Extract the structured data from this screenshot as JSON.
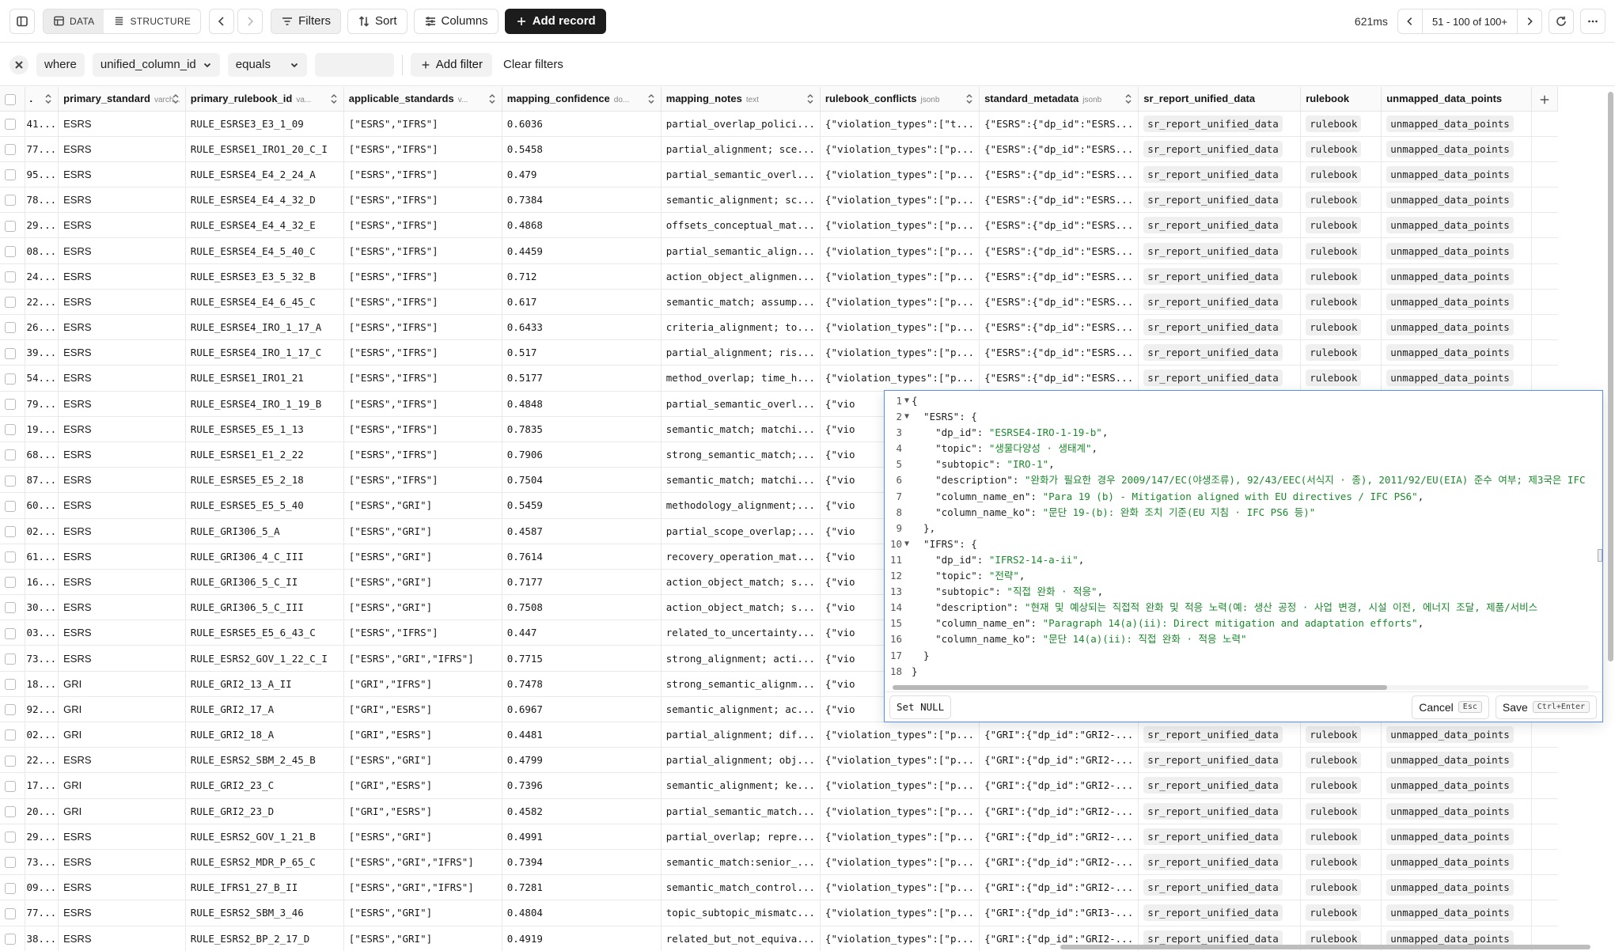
{
  "toolbar": {
    "data_label": "DATA",
    "structure_label": "STRUCTURE",
    "filters_label": "Filters",
    "sort_label": "Sort",
    "columns_label": "Columns",
    "add_record_label": "Add record",
    "timing": "621ms",
    "pagination": "51 - 100  of  100+"
  },
  "filter": {
    "where_label": "where",
    "column": "unified_column_id",
    "operator": "equals",
    "value": "",
    "add_filter_label": "Add filter",
    "clear_filters_label": "Clear filters"
  },
  "columns": [
    {
      "name": ".",
      "type": ""
    },
    {
      "name": "primary_standard",
      "type": "varch..."
    },
    {
      "name": "primary_rulebook_id",
      "type": "va..."
    },
    {
      "name": "applicable_standards",
      "type": "v..."
    },
    {
      "name": "mapping_confidence",
      "type": "do..."
    },
    {
      "name": "mapping_notes",
      "type": "text"
    },
    {
      "name": "rulebook_conflicts",
      "type": "jsonb"
    },
    {
      "name": "standard_metadata",
      "type": "jsonb"
    },
    {
      "name": "sr_report_unified_data",
      "type": ""
    },
    {
      "name": "rulebook",
      "type": ""
    },
    {
      "name": "unmapped_data_points",
      "type": ""
    }
  ],
  "rows": [
    {
      "id": "41...",
      "std": "ESRS",
      "rule": "RULE_ESRSE3_E3_1_09",
      "app": "[\"ESRS\",\"IFRS\"]",
      "conf": "0.6036",
      "notes": "partial_overlap_polici...",
      "conflicts": "{\"violation_types\":[\"t...",
      "meta": "{\"ESRS\":{\"dp_id\":\"ESRS...",
      "sr": "sr_report_unified_data",
      "rb": "rulebook",
      "un": "unmapped_data_points"
    },
    {
      "id": "77...",
      "std": "ESRS",
      "rule": "RULE_ESRSE1_IRO1_20_C_I",
      "app": "[\"ESRS\",\"IFRS\"]",
      "conf": "0.5458",
      "notes": "partial_alignment; sce...",
      "conflicts": "{\"violation_types\":[\"p...",
      "meta": "{\"ESRS\":{\"dp_id\":\"ESRS...",
      "sr": "sr_report_unified_data",
      "rb": "rulebook",
      "un": "unmapped_data_points"
    },
    {
      "id": "95...",
      "std": "ESRS",
      "rule": "RULE_ESRSE4_E4_2_24_A",
      "app": "[\"ESRS\",\"IFRS\"]",
      "conf": "0.479",
      "notes": "partial_semantic_overl...",
      "conflicts": "{\"violation_types\":[\"p...",
      "meta": "{\"ESRS\":{\"dp_id\":\"ESRS...",
      "sr": "sr_report_unified_data",
      "rb": "rulebook",
      "un": "unmapped_data_points"
    },
    {
      "id": "78...",
      "std": "ESRS",
      "rule": "RULE_ESRSE4_E4_4_32_D",
      "app": "[\"ESRS\",\"IFRS\"]",
      "conf": "0.7384",
      "notes": "semantic_alignment; sc...",
      "conflicts": "{\"violation_types\":[\"p...",
      "meta": "{\"ESRS\":{\"dp_id\":\"ESRS...",
      "sr": "sr_report_unified_data",
      "rb": "rulebook",
      "un": "unmapped_data_points"
    },
    {
      "id": "29...",
      "std": "ESRS",
      "rule": "RULE_ESRSE4_E4_4_32_E",
      "app": "[\"ESRS\",\"IFRS\"]",
      "conf": "0.4868",
      "notes": "offsets_conceptual_mat...",
      "conflicts": "{\"violation_types\":[\"p...",
      "meta": "{\"ESRS\":{\"dp_id\":\"ESRS...",
      "sr": "sr_report_unified_data",
      "rb": "rulebook",
      "un": "unmapped_data_points"
    },
    {
      "id": "08...",
      "std": "ESRS",
      "rule": "RULE_ESRSE4_E4_5_40_C",
      "app": "[\"ESRS\",\"IFRS\"]",
      "conf": "0.4459",
      "notes": "partial_semantic_align...",
      "conflicts": "{\"violation_types\":[\"p...",
      "meta": "{\"ESRS\":{\"dp_id\":\"ESRS...",
      "sr": "sr_report_unified_data",
      "rb": "rulebook",
      "un": "unmapped_data_points"
    },
    {
      "id": "24...",
      "std": "ESRS",
      "rule": "RULE_ESRSE3_E3_5_32_B",
      "app": "[\"ESRS\",\"IFRS\"]",
      "conf": "0.712",
      "notes": "action_object_alignmen...",
      "conflicts": "{\"violation_types\":[\"p...",
      "meta": "{\"ESRS\":{\"dp_id\":\"ESRS...",
      "sr": "sr_report_unified_data",
      "rb": "rulebook",
      "un": "unmapped_data_points"
    },
    {
      "id": "22...",
      "std": "ESRS",
      "rule": "RULE_ESRSE4_E4_6_45_C",
      "app": "[\"ESRS\",\"IFRS\"]",
      "conf": "0.617",
      "notes": "semantic_match; assump...",
      "conflicts": "{\"violation_types\":[\"p...",
      "meta": "{\"ESRS\":{\"dp_id\":\"ESRS...",
      "sr": "sr_report_unified_data",
      "rb": "rulebook",
      "un": "unmapped_data_points"
    },
    {
      "id": "26...",
      "std": "ESRS",
      "rule": "RULE_ESRSE4_IRO_1_17_A",
      "app": "[\"ESRS\",\"IFRS\"]",
      "conf": "0.6433",
      "notes": "criteria_alignment; to...",
      "conflicts": "{\"violation_types\":[\"p...",
      "meta": "{\"ESRS\":{\"dp_id\":\"ESRS...",
      "sr": "sr_report_unified_data",
      "rb": "rulebook",
      "un": "unmapped_data_points"
    },
    {
      "id": "39...",
      "std": "ESRS",
      "rule": "RULE_ESRSE4_IRO_1_17_C",
      "app": "[\"ESRS\",\"IFRS\"]",
      "conf": "0.517",
      "notes": "partial_alignment; ris...",
      "conflicts": "{\"violation_types\":[\"p...",
      "meta": "{\"ESRS\":{\"dp_id\":\"ESRS...",
      "sr": "sr_report_unified_data",
      "rb": "rulebook",
      "un": "unmapped_data_points"
    },
    {
      "id": "54...",
      "std": "ESRS",
      "rule": "RULE_ESRSE1_IRO1_21",
      "app": "[\"ESRS\",\"IFRS\"]",
      "conf": "0.5177",
      "notes": "method_overlap; time_h...",
      "conflicts": "{\"violation_types\":[\"p...",
      "meta": "{\"ESRS\":{\"dp_id\":\"ESRS...",
      "sr": "sr_report_unified_data",
      "rb": "rulebook",
      "un": "unmapped_data_points"
    },
    {
      "id": "79...",
      "std": "ESRS",
      "rule": "RULE_ESRSE4_IRO_1_19_B",
      "app": "[\"ESRS\",\"IFRS\"]",
      "conf": "0.4848",
      "notes": "partial_semantic_overl...",
      "conflicts": "{\"vio",
      "meta": "",
      "sr": "",
      "rb": "",
      "un": ""
    },
    {
      "id": "19...",
      "std": "ESRS",
      "rule": "RULE_ESRSE5_E5_1_13",
      "app": "[\"ESRS\",\"IFRS\"]",
      "conf": "0.7835",
      "notes": "semantic_match; matchi...",
      "conflicts": "{\"vio",
      "meta": "",
      "sr": "",
      "rb": "",
      "un": ""
    },
    {
      "id": "68...",
      "std": "ESRS",
      "rule": "RULE_ESRSE1_E1_2_22",
      "app": "[\"ESRS\",\"IFRS\"]",
      "conf": "0.7906",
      "notes": "strong_semantic_match;...",
      "conflicts": "{\"vio",
      "meta": "",
      "sr": "",
      "rb": "",
      "un": ""
    },
    {
      "id": "87...",
      "std": "ESRS",
      "rule": "RULE_ESRSE5_E5_2_18",
      "app": "[\"ESRS\",\"IFRS\"]",
      "conf": "0.7504",
      "notes": "semantic_match; matchi...",
      "conflicts": "{\"vio",
      "meta": "",
      "sr": "",
      "rb": "",
      "un": ""
    },
    {
      "id": "60...",
      "std": "ESRS",
      "rule": "RULE_ESRSE5_E5_5_40",
      "app": "[\"ESRS\",\"GRI\"]",
      "conf": "0.5459",
      "notes": "methodology_alignment;...",
      "conflicts": "{\"vio",
      "meta": "",
      "sr": "",
      "rb": "",
      "un": ""
    },
    {
      "id": "02...",
      "std": "ESRS",
      "rule": "RULE_GRI306_5_A",
      "app": "[\"ESRS\",\"GRI\"]",
      "conf": "0.4587",
      "notes": "partial_scope_overlap;...",
      "conflicts": "{\"vio",
      "meta": "",
      "sr": "",
      "rb": "",
      "un": ""
    },
    {
      "id": "61...",
      "std": "ESRS",
      "rule": "RULE_GRI306_4_C_III",
      "app": "[\"ESRS\",\"GRI\"]",
      "conf": "0.7614",
      "notes": "recovery_operation_mat...",
      "conflicts": "{\"vio",
      "meta": "",
      "sr": "",
      "rb": "",
      "un": ""
    },
    {
      "id": "16...",
      "std": "ESRS",
      "rule": "RULE_GRI306_5_C_II",
      "app": "[\"ESRS\",\"GRI\"]",
      "conf": "0.7177",
      "notes": "action_object_match; s...",
      "conflicts": "{\"vio",
      "meta": "",
      "sr": "",
      "rb": "",
      "un": ""
    },
    {
      "id": "30...",
      "std": "ESRS",
      "rule": "RULE_GRI306_5_C_III",
      "app": "[\"ESRS\",\"GRI\"]",
      "conf": "0.7508",
      "notes": "action_object_match; s...",
      "conflicts": "{\"vio",
      "meta": "",
      "sr": "",
      "rb": "",
      "un": ""
    },
    {
      "id": "03...",
      "std": "ESRS",
      "rule": "RULE_ESRSE5_E5_6_43_C",
      "app": "[\"ESRS\",\"IFRS\"]",
      "conf": "0.447",
      "notes": "related_to_uncertainty...",
      "conflicts": "{\"vio",
      "meta": "",
      "sr": "",
      "rb": "",
      "un": ""
    },
    {
      "id": "73...",
      "std": "ESRS",
      "rule": "RULE_ESRS2_GOV_1_22_C_I",
      "app": "[\"ESRS\",\"GRI\",\"IFRS\"]",
      "conf": "0.7715",
      "notes": "strong_alignment; acti...",
      "conflicts": "{\"vio",
      "meta": "",
      "sr": "",
      "rb": "",
      "un": ""
    },
    {
      "id": "18...",
      "std": "GRI",
      "rule": "RULE_GRI2_13_A_II",
      "app": "[\"GRI\",\"IFRS\"]",
      "conf": "0.7478",
      "notes": "strong_semantic_alignm...",
      "conflicts": "{\"vio",
      "meta": "",
      "sr": "",
      "rb": "",
      "un": ""
    },
    {
      "id": "92...",
      "std": "GRI",
      "rule": "RULE_GRI2_17_A",
      "app": "[\"GRI\",\"ESRS\"]",
      "conf": "0.6967",
      "notes": "semantic_alignment; ac...",
      "conflicts": "{\"vio",
      "meta": "",
      "sr": "",
      "rb": "",
      "un": ""
    },
    {
      "id": "02...",
      "std": "GRI",
      "rule": "RULE_GRI2_18_A",
      "app": "[\"GRI\",\"ESRS\"]",
      "conf": "0.4481",
      "notes": "partial_alignment; dif...",
      "conflicts": "{\"violation_types\":[\"p...",
      "meta": "{\"GRI\":{\"dp_id\":\"GRI2-...",
      "sr": "sr_report_unified_data",
      "rb": "rulebook",
      "un": "unmapped_data_points"
    },
    {
      "id": "22...",
      "std": "ESRS",
      "rule": "RULE_ESRS2_SBM_2_45_B",
      "app": "[\"ESRS\",\"GRI\"]",
      "conf": "0.4799",
      "notes": "partial_alignment; obj...",
      "conflicts": "{\"violation_types\":[\"p...",
      "meta": "{\"GRI\":{\"dp_id\":\"GRI2-...",
      "sr": "sr_report_unified_data",
      "rb": "rulebook",
      "un": "unmapped_data_points"
    },
    {
      "id": "17...",
      "std": "GRI",
      "rule": "RULE_GRI2_23_C",
      "app": "[\"GRI\",\"ESRS\"]",
      "conf": "0.7396",
      "notes": "semantic_alignment; ke...",
      "conflicts": "{\"violation_types\":[\"p...",
      "meta": "{\"GRI\":{\"dp_id\":\"GRI2-...",
      "sr": "sr_report_unified_data",
      "rb": "rulebook",
      "un": "unmapped_data_points"
    },
    {
      "id": "20...",
      "std": "GRI",
      "rule": "RULE_GRI2_23_D",
      "app": "[\"GRI\",\"ESRS\"]",
      "conf": "0.4582",
      "notes": "partial_semantic_match...",
      "conflicts": "{\"violation_types\":[\"p...",
      "meta": "{\"GRI\":{\"dp_id\":\"GRI2-...",
      "sr": "sr_report_unified_data",
      "rb": "rulebook",
      "un": "unmapped_data_points"
    },
    {
      "id": "29...",
      "std": "ESRS",
      "rule": "RULE_ESRS2_GOV_1_21_B",
      "app": "[\"ESRS\",\"GRI\"]",
      "conf": "0.4991",
      "notes": "partial_overlap; repre...",
      "conflicts": "{\"violation_types\":[\"p...",
      "meta": "{\"GRI\":{\"dp_id\":\"GRI2-...",
      "sr": "sr_report_unified_data",
      "rb": "rulebook",
      "un": "unmapped_data_points"
    },
    {
      "id": "73...",
      "std": "ESRS",
      "rule": "RULE_ESRS2_MDR_P_65_C",
      "app": "[\"ESRS\",\"GRI\",\"IFRS\"]",
      "conf": "0.7394",
      "notes": "semantic_match:senior_...",
      "conflicts": "{\"violation_types\":[\"p...",
      "meta": "{\"GRI\":{\"dp_id\":\"GRI2-...",
      "sr": "sr_report_unified_data",
      "rb": "rulebook",
      "un": "unmapped_data_points"
    },
    {
      "id": "09...",
      "std": "ESRS",
      "rule": "RULE_IFRS1_27_B_II",
      "app": "[\"ESRS\",\"GRI\",\"IFRS\"]",
      "conf": "0.7281",
      "notes": "semantic_match_control...",
      "conflicts": "{\"violation_types\":[\"p...",
      "meta": "{\"GRI\":{\"dp_id\":\"GRI2-...",
      "sr": "sr_report_unified_data",
      "rb": "rulebook",
      "un": "unmapped_data_points"
    },
    {
      "id": "77...",
      "std": "ESRS",
      "rule": "RULE_ESRS2_SBM_3_46",
      "app": "[\"ESRS\",\"GRI\"]",
      "conf": "0.4804",
      "notes": "topic_subtopic_mismatc...",
      "conflicts": "{\"violation_types\":[\"p...",
      "meta": "{\"GRI\":{\"dp_id\":\"GRI3-...",
      "sr": "sr_report_unified_data",
      "rb": "rulebook",
      "un": "unmapped_data_points"
    },
    {
      "id": "38...",
      "std": "ESRS",
      "rule": "RULE_ESRS2_BP_2_17_D",
      "app": "[\"ESRS\",\"GRI\"]",
      "conf": "0.4919",
      "notes": "related_but_not_equiva...",
      "conflicts": "{\"violation_types\":[\"p...",
      "meta": "{\"GRI\":{\"dp_id\":\"GRI2-...",
      "sr": "sr_report_unified_data",
      "rb": "rulebook",
      "un": "unmapped_data_points"
    }
  ],
  "editor": {
    "lines": [
      {
        "n": "1",
        "fold": "▼",
        "parts": [
          [
            "k",
            "{"
          ]
        ]
      },
      {
        "n": "2",
        "fold": "▼",
        "parts": [
          [
            "k",
            "  \"ESRS\": {"
          ]
        ]
      },
      {
        "n": "3",
        "fold": "",
        "parts": [
          [
            "k",
            "    \"dp_id\": "
          ],
          [
            "s",
            "\"ESRSE4-IRO-1-19-b\""
          ],
          [
            "k",
            ","
          ]
        ]
      },
      {
        "n": "4",
        "fold": "",
        "parts": [
          [
            "k",
            "    \"topic\": "
          ],
          [
            "s",
            "\"생물다양성 · 생태계\""
          ],
          [
            "k",
            ","
          ]
        ]
      },
      {
        "n": "5",
        "fold": "",
        "parts": [
          [
            "k",
            "    \"subtopic\": "
          ],
          [
            "s",
            "\"IRO-1\""
          ],
          [
            "k",
            ","
          ]
        ]
      },
      {
        "n": "6",
        "fold": "",
        "parts": [
          [
            "k",
            "    \"description\": "
          ],
          [
            "s",
            "\"완화가 필요한 경우 2009/147/EC(야생조류), 92/43/EEC(서식지 · 종), 2011/92/EU(EIA) 준수 여부; 제3국은 IFC"
          ]
        ]
      },
      {
        "n": "7",
        "fold": "",
        "parts": [
          [
            "k",
            "    \"column_name_en\": "
          ],
          [
            "s",
            "\"Para 19 (b) - Mitigation aligned with EU directives / IFC PS6\""
          ],
          [
            "k",
            ","
          ]
        ]
      },
      {
        "n": "8",
        "fold": "",
        "parts": [
          [
            "k",
            "    \"column_name_ko\": "
          ],
          [
            "s",
            "\"문단 19-(b): 완화 조치 기준(EU 지침 · IFC PS6 등)\""
          ]
        ]
      },
      {
        "n": "9",
        "fold": "",
        "parts": [
          [
            "k",
            "  },"
          ]
        ]
      },
      {
        "n": "10",
        "fold": "▼",
        "parts": [
          [
            "k",
            "  \"IFRS\": {"
          ]
        ]
      },
      {
        "n": "11",
        "fold": "",
        "parts": [
          [
            "k",
            "    \"dp_id\": "
          ],
          [
            "s",
            "\"IFRS2-14-a-ii\""
          ],
          [
            "k",
            ","
          ]
        ]
      },
      {
        "n": "12",
        "fold": "",
        "parts": [
          [
            "k",
            "    \"topic\": "
          ],
          [
            "s",
            "\"전략\""
          ],
          [
            "k",
            ","
          ]
        ]
      },
      {
        "n": "13",
        "fold": "",
        "parts": [
          [
            "k",
            "    \"subtopic\": "
          ],
          [
            "s",
            "\"직접 완화 · 적응\""
          ],
          [
            "k",
            ","
          ]
        ]
      },
      {
        "n": "14",
        "fold": "",
        "parts": [
          [
            "k",
            "    \"description\": "
          ],
          [
            "s",
            "\"현재 및 예상되는 직접적 완화 및 적응 노력(예: 생산 공정 · 사업 변경, 시설 이전, 에너지 조달, 제품/서비스"
          ]
        ]
      },
      {
        "n": "15",
        "fold": "",
        "parts": [
          [
            "k",
            "    \"column_name_en\": "
          ],
          [
            "s",
            "\"Paragraph 14(a)(ii): Direct mitigation and adaptation efforts\""
          ],
          [
            "k",
            ","
          ]
        ]
      },
      {
        "n": "16",
        "fold": "",
        "parts": [
          [
            "k",
            "    \"column_name_ko\": "
          ],
          [
            "s",
            "\"문단 14(a)(ii): 직접 완화 · 적응 노력\""
          ]
        ]
      },
      {
        "n": "17",
        "fold": "",
        "parts": [
          [
            "k",
            "  }"
          ]
        ]
      },
      {
        "n": "18",
        "fold": "",
        "parts": [
          [
            "k",
            "}"
          ]
        ]
      }
    ],
    "set_null_label": "Set NULL",
    "cancel_label": "Cancel",
    "cancel_key": "Esc",
    "save_label": "Save",
    "save_key": "Ctrl+Enter"
  }
}
